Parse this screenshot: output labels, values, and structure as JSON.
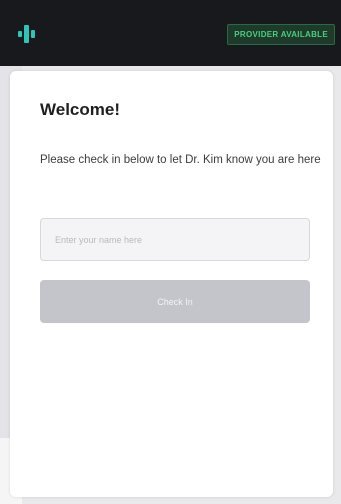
{
  "header": {
    "logo_icon": "audio-waveform-logo-icon",
    "status_badge": "PROVIDER AVAILABLE",
    "colors": {
      "bar_background": "#17191c",
      "logo": "#2ec4b6",
      "status_text": "#49d07c",
      "status_background": "#1e3a2b"
    }
  },
  "checkin": {
    "title": "Welcome!",
    "instructions": "Please check in below to let Dr. Kim know you are here",
    "name_input": {
      "value": "",
      "placeholder": "Enter your name here"
    },
    "button_label": "Check In",
    "button_color": "#c3c5cb"
  }
}
